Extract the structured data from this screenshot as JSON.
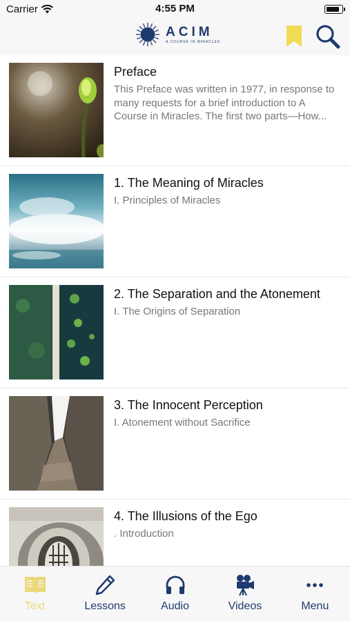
{
  "status_bar": {
    "carrier": "Carrier",
    "time": "4:55 PM"
  },
  "header": {
    "logo_title": "ACIM",
    "logo_subtitle": "A COURSE IN MIRACLES"
  },
  "list": {
    "items": [
      {
        "title": "Preface",
        "subtitle": "This Preface was written in 1977, in response to many requests for a brief introduction to A Course in Miracles. The first two parts—How..."
      },
      {
        "title": "1. The Meaning of Miracles",
        "subtitle": "I. Principles of Miracles"
      },
      {
        "title": "2. The Separation and the Atonement",
        "subtitle": "I. The Origins of Separation"
      },
      {
        "title": "3. The Innocent Perception",
        "subtitle": "I. Atonement without Sacrifice"
      },
      {
        "title": "4. The Illusions of the Ego",
        "subtitle": ". Introduction"
      }
    ]
  },
  "tabbar": {
    "tabs": [
      {
        "label": "Text",
        "icon": "book-icon",
        "active": true
      },
      {
        "label": "Lessons",
        "icon": "pencil-icon",
        "active": false
      },
      {
        "label": "Audio",
        "icon": "headphones-icon",
        "active": false
      },
      {
        "label": "Videos",
        "icon": "video-camera-icon",
        "active": false
      },
      {
        "label": "Menu",
        "icon": "more-icon",
        "active": false
      }
    ]
  },
  "colors": {
    "accent_navy": "#1f3a6e",
    "active_yellow": "#ead87a",
    "bookmark_yellow": "#f2dc53"
  }
}
